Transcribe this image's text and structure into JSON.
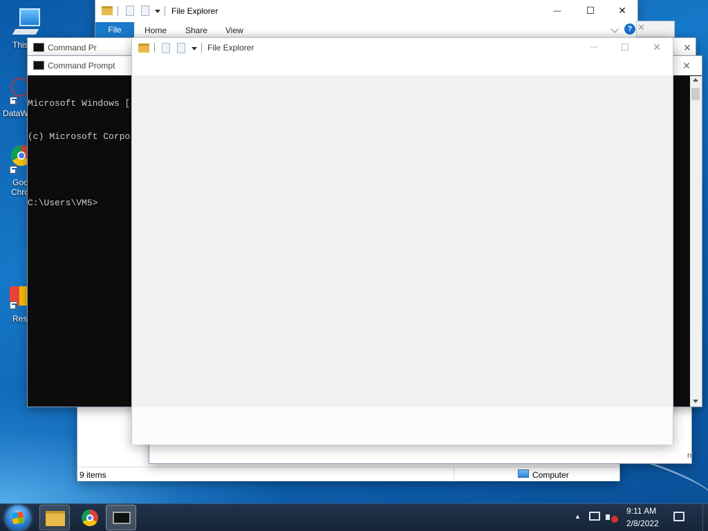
{
  "desktop": {
    "icons": [
      {
        "label": "This"
      },
      {
        "label": "DataW"
      },
      {
        "label": "Goo"
      },
      {
        "label": "Chro"
      },
      {
        "label": "Res"
      }
    ]
  },
  "back_explorer": {
    "title": "File Explorer",
    "file_tab": "File",
    "tabs": [
      "Home",
      "Share",
      "View"
    ],
    "help": "?",
    "close_glyph": "✕",
    "minimize_glyph": "—",
    "maximize_glyph": "☐"
  },
  "explorer_statusbar": {
    "items_count": "9 items",
    "location": "Computer"
  },
  "cmd_back": {
    "title": "Command Pr"
  },
  "cmd_front": {
    "title": "Command Prompt",
    "lines": [
      "Microsoft Windows [",
      "(c) Microsoft Corpo",
      "",
      "C:\\Users\\VM5>"
    ],
    "close_glyph": "✕"
  },
  "front_explorer": {
    "title": "File Explorer",
    "close_glyph": "✕",
    "minimize_glyph": "—",
    "maximize_glyph": "☐"
  },
  "taskbar": {
    "time": "9:11 AM",
    "date": "2/8/2022",
    "tray_up_arrow": "▲"
  },
  "colors": {
    "accent": "#1979ca",
    "taskbar": "#1b2b42",
    "console_bg": "#0c0c0c"
  }
}
